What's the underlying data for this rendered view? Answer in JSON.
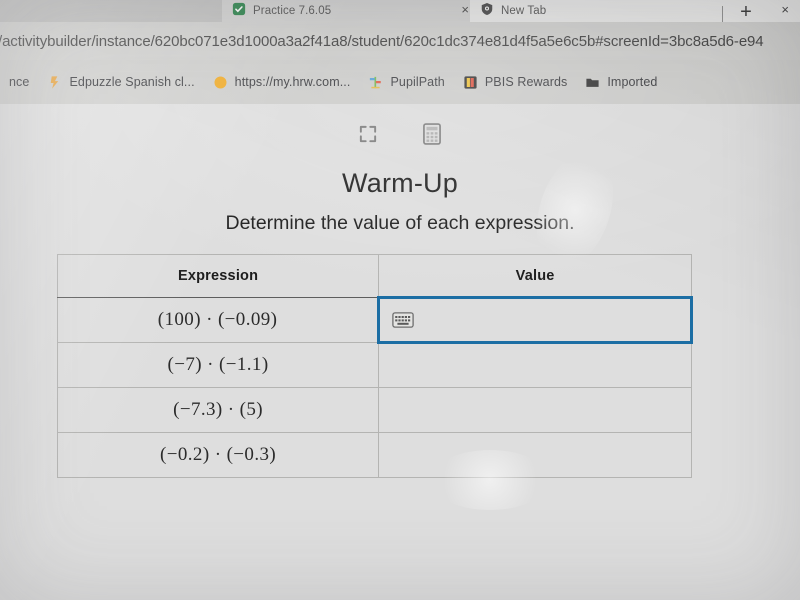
{
  "browser": {
    "tabs": [
      {
        "title": "Practice 7.6.05",
        "favicon": "practice-favicon",
        "close_label": "×",
        "active": false
      },
      {
        "title": "New Tab",
        "favicon": "shield-favicon",
        "close_label": "×",
        "active": true
      }
    ],
    "new_tab_label": "+",
    "url": "/activitybuilder/instance/620bc071e3d1000a3a2f41a8/student/620c1dc374e81d4f5a5e6c5b#screenId=3bc8a5d6-e94",
    "bookmarks": [
      {
        "label": "nce",
        "icon": "generic-bookmark-icon"
      },
      {
        "label": "Edpuzzle Spanish cl...",
        "icon": "edpuzzle-icon"
      },
      {
        "label": "https://my.hrw.com...",
        "icon": "hrw-circle-icon"
      },
      {
        "label": "PupilPath",
        "icon": "pupilpath-icon"
      },
      {
        "label": "PBIS Rewards",
        "icon": "pbis-rewards-icon"
      },
      {
        "label": "Imported",
        "icon": "folder-icon"
      }
    ]
  },
  "toolbar": {
    "fullscreen_label": "fullscreen-icon",
    "calculator_label": "calculator-icon"
  },
  "content": {
    "title": "Warm-Up",
    "subtitle": "Determine the value of each expression.",
    "table": {
      "columns": [
        "Expression",
        "Value"
      ],
      "rows": [
        {
          "expression": "(100) · (−0.09)",
          "value": "",
          "active": true,
          "keypad_icon": "keyboard-icon"
        },
        {
          "expression": "(−7) · (−1.1)",
          "value": "",
          "active": false,
          "keypad_icon": ""
        },
        {
          "expression": "(−7.3) · (5)",
          "value": "",
          "active": false,
          "keypad_icon": ""
        },
        {
          "expression": "(−0.2) · (−0.3)",
          "value": "",
          "active": false,
          "keypad_icon": ""
        }
      ]
    }
  },
  "colors": {
    "active_cell_border": "#1c6ea4",
    "page_background": "#dedede",
    "chrome_background": "#c9c9c8",
    "text": "#1f1f1f"
  }
}
